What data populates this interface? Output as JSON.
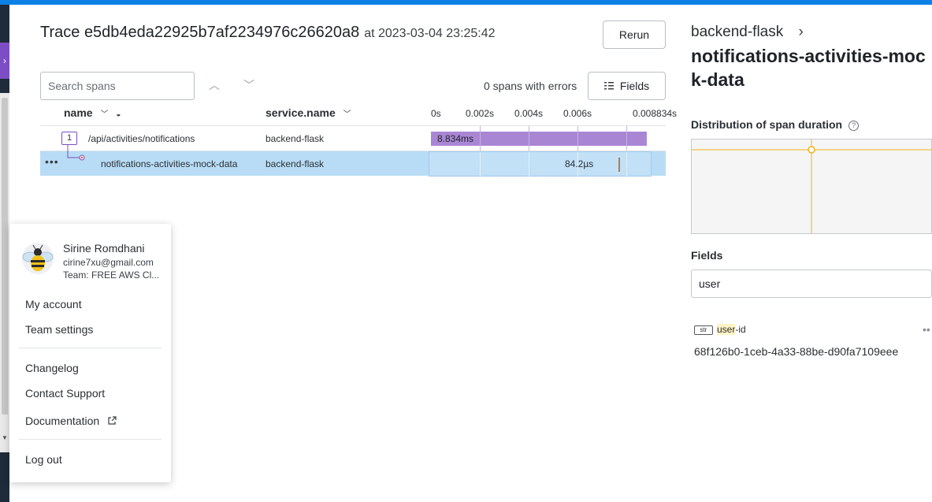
{
  "trace": {
    "label": "Trace e5db4eda22925b7af2234976c26620a8",
    "timestamp": "at 2023-03-04 23:25:42",
    "rerun_label": "Rerun"
  },
  "toolbar": {
    "search_placeholder": "Search spans",
    "errors_text": "0 spans with errors",
    "fields_label": "Fields"
  },
  "table": {
    "columns": [
      "name",
      "service.name"
    ],
    "ticks": [
      "0s",
      "0.002s",
      "0.004s",
      "0.006s",
      "0.008834s"
    ],
    "rows": [
      {
        "count": "1",
        "name": "/api/activities/notifications",
        "service": "backend-flask",
        "duration_label": "8.834ms"
      },
      {
        "name": "notifications-activities-mock-data",
        "service": "backend-flask",
        "duration_label": "84.2µs"
      }
    ]
  },
  "panel": {
    "service": "backend-flask",
    "span_name": "notifications-activities-mock-data",
    "distribution_label": "Distribution of span duration",
    "help_icon": "?",
    "fields_label": "Fields",
    "fields_filter": "user",
    "field": {
      "type": "str",
      "name_match": "user",
      "name_rest": "-id",
      "value": "68f126b0-1ceb-4a33-88be-d90fa7109eee"
    }
  },
  "user_menu": {
    "name": "Sirine Romdhani",
    "email": "cirine7xu@gmail.com",
    "team": "Team: FREE AWS Cl...",
    "items": [
      "My account",
      "Team settings",
      "Changelog",
      "Contact Support",
      "Documentation",
      "Log out"
    ]
  },
  "colors": {
    "accent": "#0d80e6",
    "span_bar": "#a986d4",
    "selected_row": "#b8dcf5",
    "heatmap_line": "#f2b21a"
  }
}
